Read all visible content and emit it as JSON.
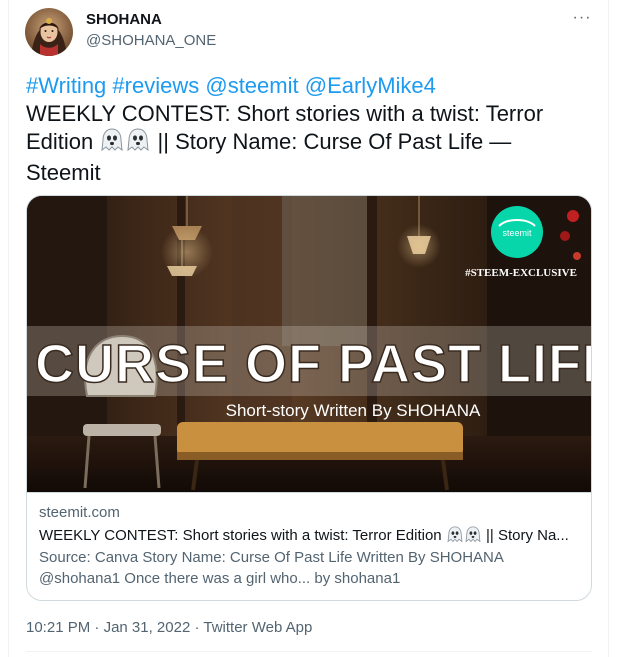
{
  "author": {
    "display_name": "SHOHANA",
    "handle": "@SHOHANA_ONE"
  },
  "tweet": {
    "tag1": "#Writing",
    "tag2": "#reviews",
    "mention1": "@steemit",
    "mention2": "@EarlyMike4",
    "line2": "WEEKLY CONTEST: Short stories with a twist: Terror",
    "line3a": "Edition",
    "line3b": "|| Story Name: Curse Of Past Life —",
    "line4": "Steemit"
  },
  "card": {
    "image": {
      "hashtag": "#STEEM-EXCLUSIVE",
      "logo_text": "steemit",
      "headline": "CURSE OF PAST LIFE",
      "subline": "Short-story Written By SHOHANA"
    },
    "domain": "steemit.com",
    "title_a": "WEEKLY CONTEST: Short stories with a twist: Terror Edition",
    "title_b": "|| Story Na...",
    "description_line1": "Source: Canva Story Name: Curse Of Past Life Written By SHOHANA",
    "description_line2": "@shohana1 Once there was a girl who... by shohana1"
  },
  "timestamp": {
    "time": "10:21 PM",
    "separator1": " · ",
    "date": "Jan 31, 2022",
    "separator2": " · ",
    "app": "Twitter Web App"
  },
  "more_glyph": "···",
  "colors": {
    "link": "#1d9bf0",
    "secondary_text": "#536471",
    "primary_text": "#0f1419",
    "border": "#cfd9de",
    "steemit_green": "#06d6a9"
  },
  "icons": [
    "ghost-emoji-icon",
    "more-options-icon",
    "steemit-logo-icon"
  ]
}
